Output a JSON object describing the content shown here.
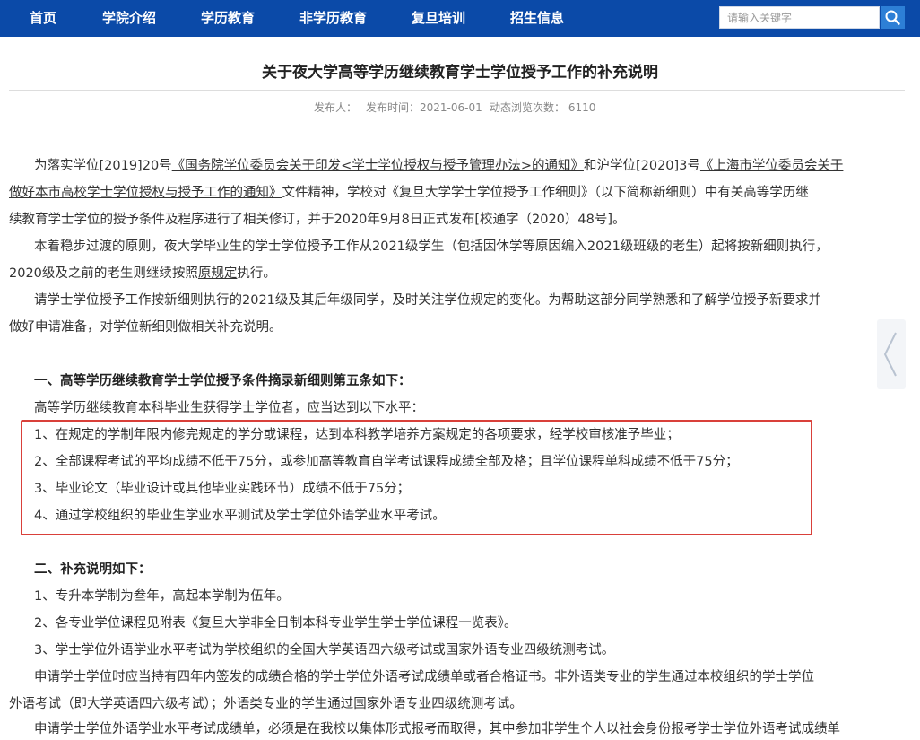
{
  "nav": {
    "items": [
      "首页",
      "学院介绍",
      "学历教育",
      "非学历教育",
      "复旦培训",
      "招生信息"
    ],
    "search_placeholder": "请输入关键字"
  },
  "article": {
    "title": "关于夜大学高等学历继续教育学士学位授予工作的补充说明",
    "meta": {
      "publisher": "发布人：",
      "date": "发布时间：2021-06-01",
      "views": "动态浏览次数： 6110"
    },
    "p1": {
      "t1": "为落实学位[2019]20号",
      "link1": "《国务院学位委员会关于印发<学士学位授权与授予管理办法>的通知》",
      "t2": "和沪学位[2020]3号",
      "link2a": "《上海市学位委员会关于",
      "link2b": "做好本市高校学士学位授权与授予工作的通知》",
      "t3": "文件精神，学校对《复旦大学学士学位授予工作细则》（以下简称新细则）中有关高等学历继",
      "t4": "续教育学士学位的授予条件及程序进行了相关修订，并于2020年9月8日正式发布[校通字（2020）48号]。"
    },
    "p2": {
      "t1": "本着稳步过渡的原则，夜大学毕业生的学士学位授予工作从2021级学生（包括因休学等原因编入2021级班级的老生）起将按新细则执行，",
      "t2": "2020级及之前的老生则继续按照",
      "link": "原规定",
      "t3": "执行。"
    },
    "p3": {
      "t1": "请学士学位授予工作按新细则执行的2021级及其后年级同学，及时关注学位规定的变化。为帮助这部分同学熟悉和了解学位授予新要求并",
      "t2": "做好申请准备，对学位新细则做相关补充说明。"
    },
    "section1": {
      "heading": "一、高等学历继续教育学士学位授予条件摘录新细则第五条如下：",
      "intro": "高等学历继续教育本科毕业生获得学士学位者，应当达到以下水平：",
      "items": [
        "1、在规定的学制年限内修完规定的学分或课程，达到本科教学培养方案规定的各项要求，经学校审核准予毕业；",
        "2、全部课程考试的平均成绩不低于75分，或参加高等教育自学考试课程成绩全部及格；且学位课程单科成绩不低于75分；",
        "3、毕业论文（毕业设计或其他毕业实践环节）成绩不低于75分；",
        "4、通过学校组织的毕业生学业水平测试及学士学位外语学业水平考试。"
      ]
    },
    "section2": {
      "heading": "二、补充说明如下：",
      "items": [
        "1、专升本学制为叁年，高起本学制为伍年。",
        "2、各专业学位课程见附表《复旦大学非全日制本科专业学生学士学位课程一览表》。",
        "3、学士学位外语学业水平考试为学校组织的全国大学英语四六级考试或国家外语专业四级统测考试。"
      ],
      "p_a": "申请学士学位时应当持有四年内签发的成绩合格的学士学位外语考试成绩单或者合格证书。非外语类专业的学生通过本校组织的学士学位",
      "p_b": "外语考试（即大学英语四六级考试）；外语类专业的学生通过国家外语专业四级统测考试。",
      "p_c": "申请学士学位外语学业水平考试成绩单，必须是在我校以集体形式报考而取得，其中参加非学生个人以社会身份报考学士学位外语考试成绩单"
    }
  },
  "colors": {
    "nav_bg": "#0b4aa8",
    "accent_red": "#d9403a",
    "search_button": "#2d7fd6"
  }
}
